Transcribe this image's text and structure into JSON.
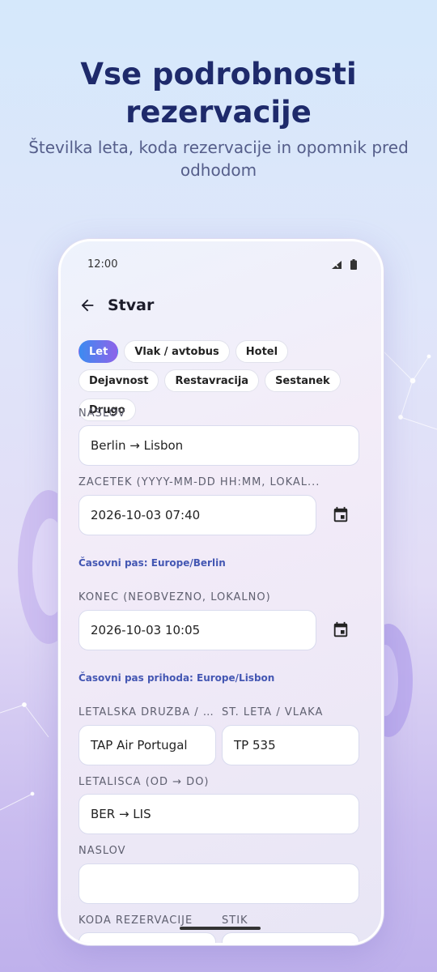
{
  "headline": {
    "title": "Vse podrobnosti rezervacije",
    "subtitle": "Številka leta, koda rezervacije in opomnik pred odhodom"
  },
  "status_bar": {
    "time": "12:00"
  },
  "app_bar": {
    "title": "Stvar"
  },
  "categories": {
    "items": [
      "Let",
      "Vlak / avtobus",
      "Hotel",
      "Dejavnost",
      "Restavracija",
      "Sestanek",
      "Drugo"
    ],
    "selected": "Let"
  },
  "form": {
    "title_label": "NASLOV",
    "title_value": "Berlin → Lisbon",
    "start_label": "ZAČETEK (YYYY-MM-DD HH:MM, LOKAL...",
    "start_value": "2026-10-03 07:40",
    "start_tz": "Časovni pas: Europe/Berlin",
    "end_label": "KONEC (NEOBVEZNO, LOKALNO)",
    "end_value": "2026-10-03 10:05",
    "end_tz": "Časovni pas prihoda: Europe/Lisbon",
    "airline_label": "LETALSKA DRUŽBA / P...",
    "airline_value": "TAP Air Portugal",
    "flight_label": "ŠT. LETA / VLAKA",
    "flight_value": "TP 535",
    "airports_label": "LETALIŠČA (OD → DO)",
    "airports_value": "BER → LIS",
    "address_label": "NASLOV",
    "address_value": "",
    "booking_label": "KODA REZERVACIJE",
    "contact_label": "STIK"
  },
  "colors": {
    "accent_start": "#3d8bf0",
    "accent_end": "#8d63e9",
    "headline": "#1e2a6b",
    "tz_note": "#4457b3"
  }
}
